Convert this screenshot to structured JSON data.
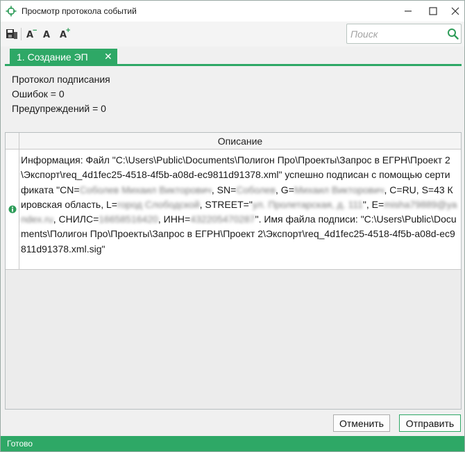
{
  "window": {
    "title": "Просмотр протокола событий",
    "controls": [
      "minimize-icon",
      "maximize-icon",
      "close-icon"
    ]
  },
  "toolbar": {
    "buttons": [
      {
        "icon": "save-icon"
      },
      {
        "icon": "font-decrease-icon",
        "label": "A",
        "mark": "−"
      },
      {
        "icon": "font-normal-icon",
        "label": "A"
      },
      {
        "icon": "font-increase-icon",
        "label": "A",
        "mark": "+"
      }
    ],
    "search": {
      "placeholder": "Поиск",
      "value": "",
      "icon": "search-icon"
    }
  },
  "tabs": [
    {
      "label": "1. Создание ЭП",
      "close": "✕",
      "active": true
    }
  ],
  "summary": {
    "line1": "Протокол подписания",
    "line2": "Ошибок = 0",
    "line3": "Предупреждений = 0"
  },
  "grid": {
    "column": "Описание",
    "rows": [
      {
        "icon": "info-icon",
        "parts": [
          {
            "t": "Информация: Файл \"C:\\Users\\Public\\Documents\\Полигон Про\\Проекты\\Запрос в ЕГРН\\Проект 2\\Экспорт\\req_4d1fec25-4518-4f5b-a08d-ec9811d91378.xml\" успешно подписан с помощью сертификата \"CN="
          },
          {
            "t": "Соболев Михаил Викторович",
            "blur": true
          },
          {
            "t": ", SN="
          },
          {
            "t": "Соболев",
            "blur": true
          },
          {
            "t": ", G="
          },
          {
            "t": "Михаил Викторович",
            "blur": true
          },
          {
            "t": ", C=RU, S=43 Кировская область, L="
          },
          {
            "t": "город Слободской",
            "blur": true
          },
          {
            "t": ", STREET=\""
          },
          {
            "t": "ул. Пролетарская, д. 111",
            "blur": true
          },
          {
            "t": "\", E="
          },
          {
            "t": "misha79889@yandex.ru",
            "blur": true
          },
          {
            "t": ", СНИЛС="
          },
          {
            "t": "16658516420",
            "blur": true
          },
          {
            "t": ", ИНН="
          },
          {
            "t": "432205470287",
            "blur": true
          },
          {
            "t": "\". Имя файла подписи: \"C:\\Users\\Public\\Documents\\Полигон Про\\Проекты\\Запрос в ЕГРН\\Проект 2\\Экспорт\\req_4d1fec25-4518-4f5b-a08d-ec9811d91378.xml.sig\""
          }
        ]
      }
    ]
  },
  "buttons": {
    "cancel": "Отменить",
    "send": "Отправить"
  },
  "status": {
    "text": "Готово"
  },
  "colors": {
    "accent": "#2ea866",
    "info": "#2e9c59"
  }
}
